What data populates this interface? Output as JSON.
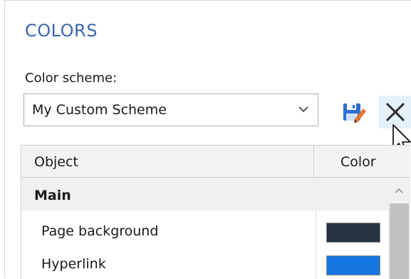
{
  "panel": {
    "title": "COLORS",
    "scheme_label": "Color scheme:",
    "scheme_value": "My Custom Scheme",
    "save_icon": "save-scheme-icon",
    "delete_icon": "close-icon"
  },
  "table": {
    "headers": {
      "object": "Object",
      "color": "Color"
    },
    "group": "Main",
    "rows": [
      {
        "label": "Page background",
        "color": "#263340"
      },
      {
        "label": "Hyperlink",
        "color": "#1478e0"
      }
    ]
  },
  "colors": {
    "accent_title": "#3a66b0",
    "save_icon_blue": "#2e6fd1",
    "save_icon_orange": "#e8732c"
  }
}
